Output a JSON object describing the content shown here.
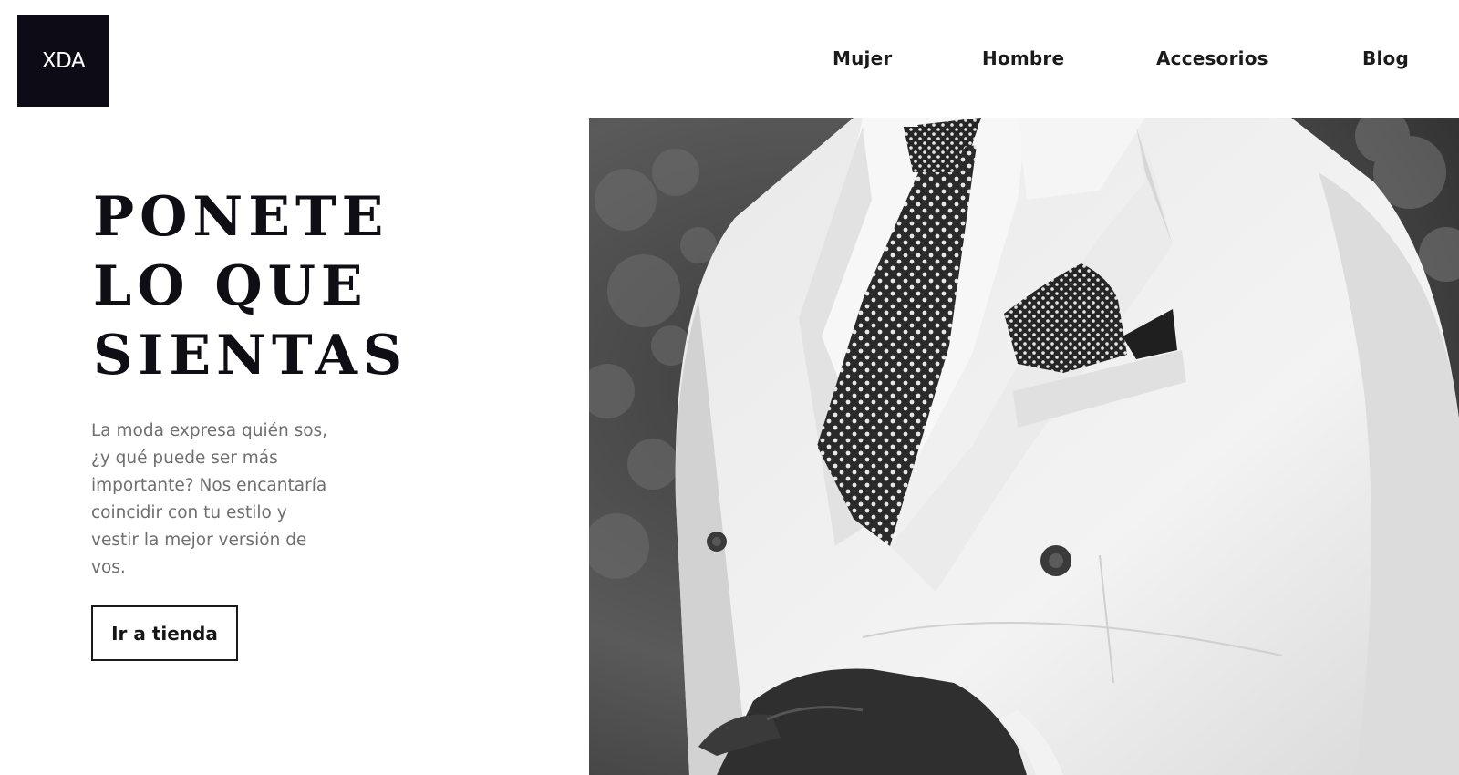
{
  "brand": {
    "logo_text": "XDA",
    "logo_bg": "#0d0b16"
  },
  "nav": {
    "items": [
      {
        "label": "Mujer"
      },
      {
        "label": "Hombre"
      },
      {
        "label": "Accesorios"
      },
      {
        "label": "Blog"
      }
    ]
  },
  "hero": {
    "title_lines": [
      "PONETE",
      "LO QUE",
      "SIENTAS"
    ],
    "description": "La moda expresa quién sos, ¿y qué puede ser más importante? Nos encantaría coincidir con tu estilo y vestir la mejor versión de vos.",
    "cta_label": "Ir a tienda"
  }
}
